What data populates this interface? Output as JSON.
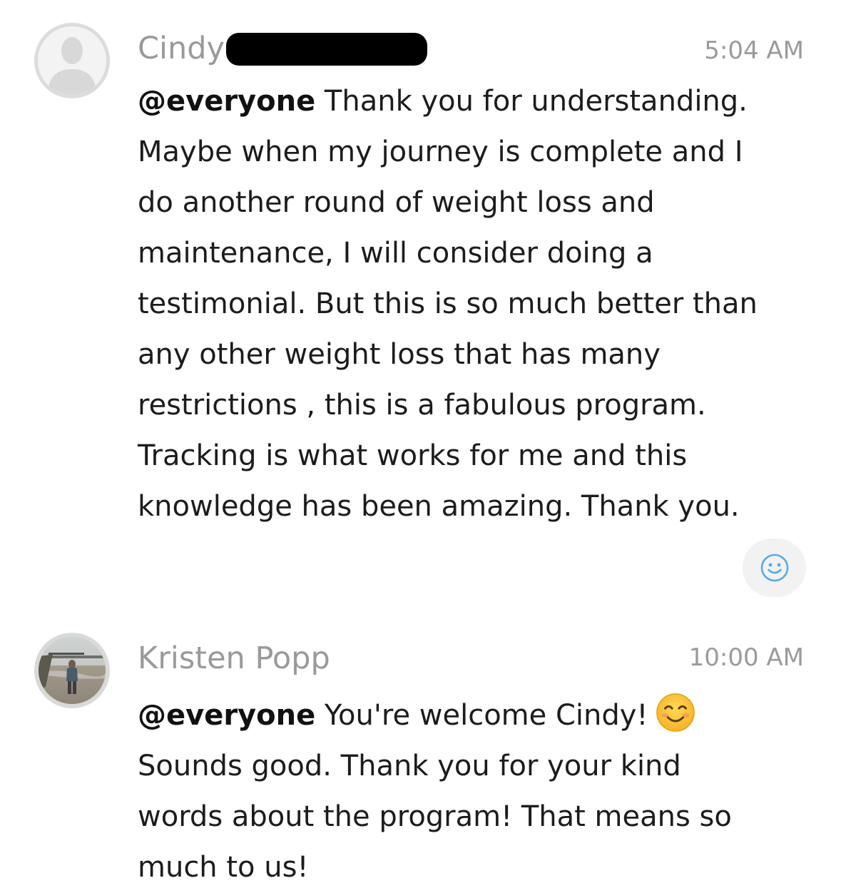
{
  "messages": [
    {
      "author": "Cindy",
      "time": "5:04 AM",
      "mention": "@everyone",
      "lines": [
        " Thank you for understanding.",
        "Maybe when my journey is complete and I",
        "do  another round of weight loss and",
        "maintenance, I will consider doing a",
        "testimonial. But this is so much better than",
        "any other weight loss that has many",
        "restrictions , this is a fabulous program.",
        "Tracking is what works for me and this",
        "knowledge has been amazing. Thank you."
      ],
      "avatar_icon": "default-user-avatar-icon",
      "reaction_icon": "add-reaction-smiley-icon"
    },
    {
      "author": "Kristen Popp",
      "time": "10:00 AM",
      "mention": "@everyone",
      "lines": [
        " You're welcome Cindy!",
        "Sounds good. Thank you for your kind",
        "words about the program! That means so",
        "much to us!"
      ],
      "avatar_icon": "beach-photo-avatar",
      "inline_emoji": "smiling-face-emoji"
    }
  ]
}
